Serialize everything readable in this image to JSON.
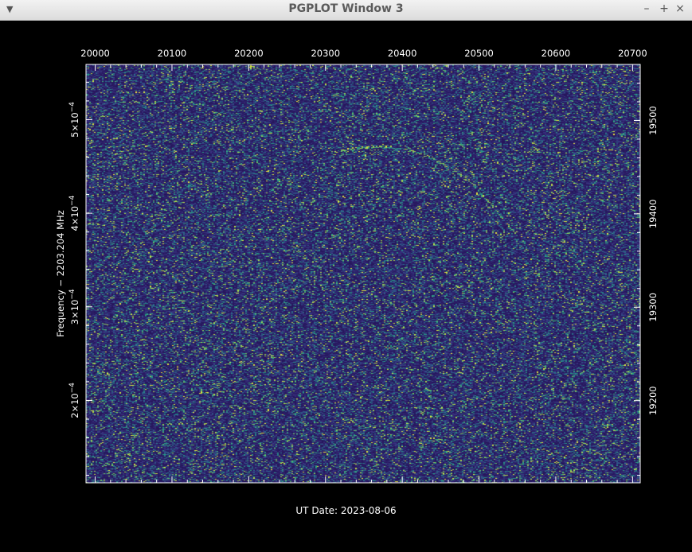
{
  "window": {
    "title": "PGPLOT Window 3",
    "menu_icon": "menu-arrow-icon",
    "min_label": "–",
    "max_label": "+",
    "close_label": "×"
  },
  "colors": {
    "background": "#000000",
    "frame": "#ffffff",
    "heatmap_low": "#2f2a6e",
    "heatmap_mid": "#2a8c8c",
    "heatmap_high": "#f5e94a"
  },
  "chart_data": {
    "type": "heatmap",
    "title": "",
    "xlabel": "UT Date: 2023-08-06",
    "ylabel": "Frequency − 2203.204 MHz",
    "x_top_ticks": [
      "20000",
      "20100",
      "20200",
      "20300",
      "20400",
      "20500",
      "20600",
      "20700"
    ],
    "x_range": [
      19988,
      20710
    ],
    "y_left_ticks": [
      {
        "value": 0.0005,
        "mantissa": "5",
        "exp": "−4"
      },
      {
        "value": 0.0004,
        "mantissa": "4",
        "exp": "−4"
      },
      {
        "value": 0.0003,
        "mantissa": "3",
        "exp": "−4"
      },
      {
        "value": 0.0002,
        "mantissa": "2",
        "exp": "−4"
      }
    ],
    "y_left_range": [
      0.000112,
      0.000559
    ],
    "y_right_ticks": [
      "19500",
      "19400",
      "19300",
      "19200"
    ],
    "y_right_range": [
      19112,
      19560
    ],
    "grid": false,
    "signal_trace": {
      "x": [
        20300,
        20340,
        20370,
        20400,
        20430,
        20460,
        20490,
        20520,
        20550
      ],
      "y": [
        0.000465,
        0.00047,
        0.000472,
        0.000469,
        0.000462,
        0.00045,
        0.000432,
        0.000405,
        0.000375
      ]
    }
  }
}
